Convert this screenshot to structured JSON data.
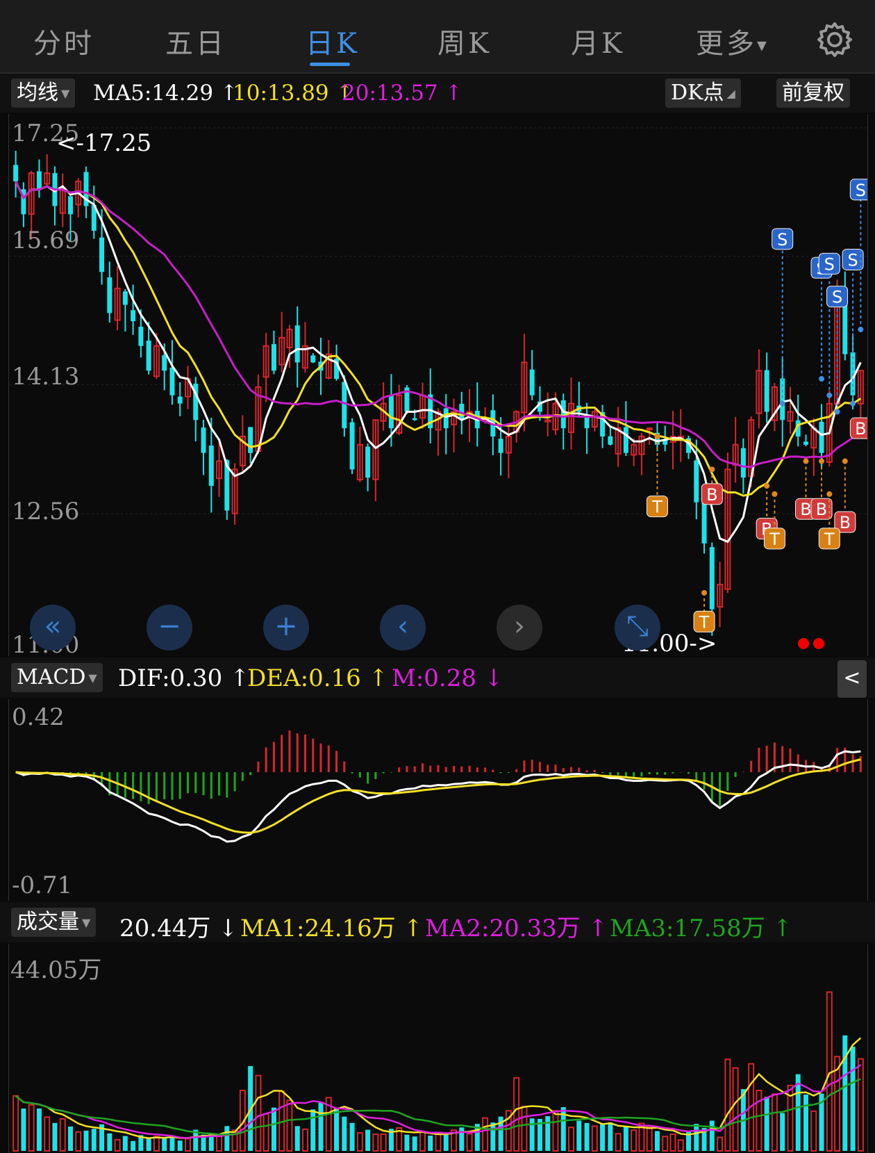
{
  "tabs": [
    {
      "label": "分时"
    },
    {
      "label": "五日"
    },
    {
      "label": "日K",
      "active": true
    },
    {
      "label": "周K"
    },
    {
      "label": "月K"
    },
    {
      "label": "更多"
    }
  ],
  "ma_row": {
    "selector": "均线",
    "ma5": "MA5:14.29 ↑",
    "ma10": "10:13.89 ↑",
    "ma20": "20:13.57 ↑",
    "dk_button": "DK点",
    "adjust_button": "前复权"
  },
  "price_axis": [
    "17.25",
    "15.69",
    "14.13",
    "12.56",
    "11.00"
  ],
  "price_annotations": {
    "high": "<-17.25",
    "low": "11.00->"
  },
  "macd_row": {
    "selector": "MACD",
    "dif": "DIF:0.30 ↑",
    "dea": "DEA:0.16 ↑",
    "m": "M:0.28 ↓"
  },
  "macd_axis": [
    "0.42",
    "-0.71"
  ],
  "vol_row": {
    "selector": "成交量",
    "vol": "20.44万 ↓",
    "ma1": "MA1:24.16万 ↑",
    "ma2": "MA2:20.33万 ↑",
    "ma3": "MA3:17.58万 ↑"
  },
  "vol_axis": [
    "44.05万"
  ],
  "controls": {
    "back": "«",
    "zoom_out": "−",
    "zoom_in": "+",
    "prev": "‹",
    "next": "›",
    "fullscreen": "⤡",
    "collapse": "<"
  },
  "signal_labels": {
    "sell": "S",
    "buy": "B",
    "t": "T"
  },
  "colors": {
    "up": "#d8262b",
    "down": "#1ce3ea",
    "ma5": "#ffffff",
    "ma10": "#f4e024",
    "ma20": "#c71ec7",
    "accent": "#3d8fe6"
  },
  "chart_data": {
    "type": "candlestick",
    "ylim": [
      11.0,
      17.25
    ],
    "close": [
      16.6,
      16.2,
      16.7,
      16.5,
      16.7,
      16.3,
      16.5,
      16.2,
      16.6,
      16.3,
      16.0,
      15.5,
      15.0,
      15.3,
      15.1,
      14.9,
      14.6,
      14.3,
      14.6,
      14.3,
      14.0,
      13.9,
      14.2,
      13.7,
      13.3,
      12.9,
      13.2,
      12.6,
      13.1,
      13.5,
      13.3,
      14.1,
      14.6,
      14.3,
      14.7,
      14.8,
      14.4,
      14.6,
      14.4,
      14.3,
      14.5,
      14.2,
      13.6,
      13.1,
      13.4,
      13.0,
      13.7,
      13.9,
      13.6,
      14.0,
      13.8,
      13.7,
      14.0,
      13.6,
      13.8,
      13.6,
      13.8,
      13.7,
      13.8,
      13.6,
      13.7,
      13.5,
      13.3,
      13.5,
      13.8,
      14.4,
      14.0,
      13.8,
      13.7,
      13.9,
      13.6,
      13.9,
      13.8,
      13.6,
      13.8,
      13.5,
      13.4,
      13.6,
      13.3,
      13.4,
      13.5,
      13.6,
      13.4,
      13.4,
      13.5,
      13.5,
      13.3,
      12.7,
      12.2,
      11.4,
      11.7,
      13.1,
      13.4,
      13.0,
      13.7,
      14.3,
      13.8,
      14.1,
      13.7,
      13.8,
      13.5,
      13.4,
      13.6,
      13.3,
      13.9,
      15.3,
      14.5,
      14.0,
      14.3
    ],
    "volume": [
      12.2,
      9.4,
      10.2,
      9.4,
      7.5,
      6.2,
      7.1,
      5.4,
      4.2,
      4.5,
      4.9,
      5.9,
      3.9,
      2.5,
      3.3,
      2.2,
      3.5,
      2.7,
      3.2,
      2.8,
      3.3,
      2.3,
      2.7,
      4.7,
      3.6,
      3.9,
      3.3,
      5.5,
      4.6,
      13.4,
      18.8,
      16.7,
      8.2,
      9.6,
      13.2,
      11.2,
      5.5,
      4.8,
      9.2,
      10.9,
      11.8,
      9.6,
      7.6,
      6.2,
      4.0,
      4.7,
      3.7,
      3.7,
      4.9,
      5.1,
      3.6,
      3.2,
      4.2,
      3.4,
      4.1,
      3.6,
      4.6,
      5.2,
      3.8,
      6.0,
      7.3,
      6.3,
      7.6,
      8.9,
      16.2,
      9.8,
      7.2,
      7.1,
      7.7,
      8.9,
      9.7,
      5.2,
      6.7,
      6.2,
      5.5,
      6.1,
      6.3,
      3.8,
      5.4,
      4.6,
      6.1,
      5.3,
      4.4,
      3.2,
      3.7,
      2.4,
      4.3,
      6.0,
      5.1,
      6.7,
      3.0,
      20.3,
      18.4,
      13.7,
      19.3,
      13.4,
      12.0,
      12.6,
      8.4,
      14.5,
      17.0,
      12.5,
      8.8,
      12.7,
      35.2,
      20.9,
      25.6,
      23.1,
      20.4
    ]
  }
}
